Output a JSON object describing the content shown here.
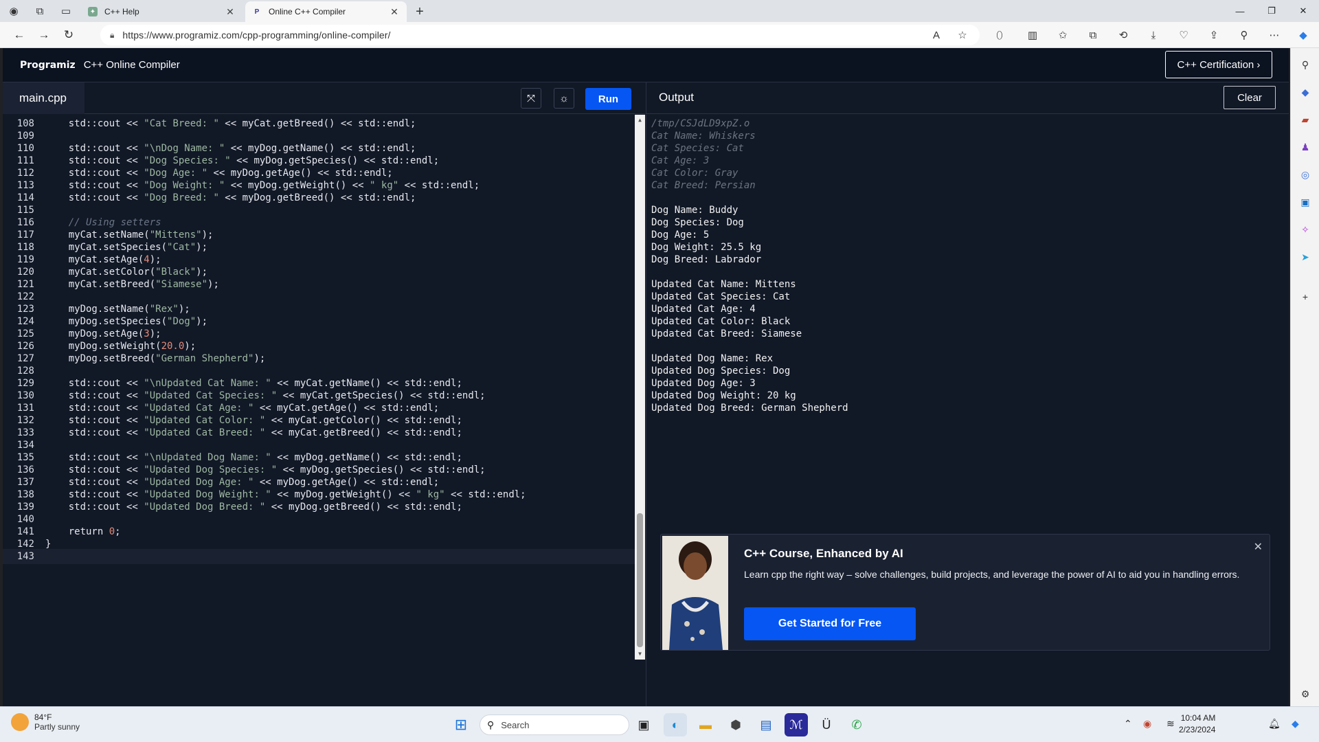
{
  "browser": {
    "tabs": [
      {
        "title": "C++ Help",
        "active": false
      },
      {
        "title": "Online C++ Compiler",
        "active": true
      }
    ],
    "url": "https://www.programiz.com/cpp-programming/online-compiler/"
  },
  "app": {
    "logo": "Programiz",
    "title": "C++ Online Compiler",
    "certification_button": "C++ Certification ›",
    "file_tab": "main.cpp",
    "run_button": "Run",
    "output_title": "Output",
    "clear_button": "Clear"
  },
  "code_lines": [
    {
      "n": "108",
      "code": "    std::cout << \"Cat Breed: \" << myCat.getBreed() << std::endl;"
    },
    {
      "n": "109",
      "code": ""
    },
    {
      "n": "110",
      "code": "    std::cout << \"\\nDog Name: \" << myDog.getName() << std::endl;"
    },
    {
      "n": "111",
      "code": "    std::cout << \"Dog Species: \" << myDog.getSpecies() << std::endl;"
    },
    {
      "n": "112",
      "code": "    std::cout << \"Dog Age: \" << myDog.getAge() << std::endl;"
    },
    {
      "n": "113",
      "code": "    std::cout << \"Dog Weight: \" << myDog.getWeight() << \" kg\" << std::endl;"
    },
    {
      "n": "114",
      "code": "    std::cout << \"Dog Breed: \" << myDog.getBreed() << std::endl;"
    },
    {
      "n": "115",
      "code": ""
    },
    {
      "n": "116",
      "code": "    // Using setters"
    },
    {
      "n": "117",
      "code": "    myCat.setName(\"Mittens\");"
    },
    {
      "n": "118",
      "code": "    myCat.setSpecies(\"Cat\");"
    },
    {
      "n": "119",
      "code": "    myCat.setAge(4);"
    },
    {
      "n": "120",
      "code": "    myCat.setColor(\"Black\");"
    },
    {
      "n": "121",
      "code": "    myCat.setBreed(\"Siamese\");"
    },
    {
      "n": "122",
      "code": ""
    },
    {
      "n": "123",
      "code": "    myDog.setName(\"Rex\");"
    },
    {
      "n": "124",
      "code": "    myDog.setSpecies(\"Dog\");"
    },
    {
      "n": "125",
      "code": "    myDog.setAge(3);"
    },
    {
      "n": "126",
      "code": "    myDog.setWeight(20.0);"
    },
    {
      "n": "127",
      "code": "    myDog.setBreed(\"German Shepherd\");"
    },
    {
      "n": "128",
      "code": ""
    },
    {
      "n": "129",
      "code": "    std::cout << \"\\nUpdated Cat Name: \" << myCat.getName() << std::endl;"
    },
    {
      "n": "130",
      "code": "    std::cout << \"Updated Cat Species: \" << myCat.getSpecies() << std::endl;"
    },
    {
      "n": "131",
      "code": "    std::cout << \"Updated Cat Age: \" << myCat.getAge() << std::endl;"
    },
    {
      "n": "132",
      "code": "    std::cout << \"Updated Cat Color: \" << myCat.getColor() << std::endl;"
    },
    {
      "n": "133",
      "code": "    std::cout << \"Updated Cat Breed: \" << myCat.getBreed() << std::endl;"
    },
    {
      "n": "134",
      "code": ""
    },
    {
      "n": "135",
      "code": "    std::cout << \"\\nUpdated Dog Name: \" << myDog.getName() << std::endl;"
    },
    {
      "n": "136",
      "code": "    std::cout << \"Updated Dog Species: \" << myDog.getSpecies() << std::endl;"
    },
    {
      "n": "137",
      "code": "    std::cout << \"Updated Dog Age: \" << myDog.getAge() << std::endl;"
    },
    {
      "n": "138",
      "code": "    std::cout << \"Updated Dog Weight: \" << myDog.getWeight() << \" kg\" << std::endl;"
    },
    {
      "n": "139",
      "code": "    std::cout << \"Updated Dog Breed: \" << myDog.getBreed() << std::endl;"
    },
    {
      "n": "140",
      "code": ""
    },
    {
      "n": "141",
      "code": "    return 0;"
    },
    {
      "n": "142",
      "code": "}"
    },
    {
      "n": "143",
      "code": ""
    }
  ],
  "output_lines": [
    {
      "text": "/tmp/CSJdLD9xpZ.o",
      "dim": true
    },
    {
      "text": "Cat Name: Whiskers",
      "dim": true
    },
    {
      "text": "Cat Species: Cat",
      "dim": true
    },
    {
      "text": "Cat Age: 3",
      "dim": true
    },
    {
      "text": "Cat Color: Gray",
      "dim": true
    },
    {
      "text": "Cat Breed: Persian",
      "dim": true
    },
    {
      "text": "",
      "dim": false
    },
    {
      "text": "Dog Name: Buddy",
      "dim": false
    },
    {
      "text": "Dog Species: Dog",
      "dim": false
    },
    {
      "text": "Dog Age: 5",
      "dim": false
    },
    {
      "text": "Dog Weight: 25.5 kg",
      "dim": false
    },
    {
      "text": "Dog Breed: Labrador",
      "dim": false
    },
    {
      "text": "",
      "dim": false
    },
    {
      "text": "Updated Cat Name: Mittens",
      "dim": false
    },
    {
      "text": "Updated Cat Species: Cat",
      "dim": false
    },
    {
      "text": "Updated Cat Age: 4",
      "dim": false
    },
    {
      "text": "Updated Cat Color: Black",
      "dim": false
    },
    {
      "text": "Updated Cat Breed: Siamese",
      "dim": false
    },
    {
      "text": "",
      "dim": false
    },
    {
      "text": "Updated Dog Name: Rex",
      "dim": false
    },
    {
      "text": "Updated Dog Species: Dog",
      "dim": false
    },
    {
      "text": "Updated Dog Age: 3",
      "dim": false
    },
    {
      "text": "Updated Dog Weight: 20 kg",
      "dim": false
    },
    {
      "text": "Updated Dog Breed: German Shepherd",
      "dim": false
    }
  ],
  "promo": {
    "title": "C++ Course, Enhanced by AI",
    "description": "Learn cpp the right way – solve challenges, build projects, and leverage the power of AI to aid you in handling errors.",
    "cta": "Get Started for Free"
  },
  "taskbar": {
    "temperature": "84°F",
    "condition": "Partly sunny",
    "search_placeholder": "Search",
    "time": "10:04 AM",
    "date": "2/23/2024"
  },
  "colors": {
    "brand_blue": "#0556f3",
    "editor_bg": "#111826",
    "string": "#9fb9a3",
    "number": "#e58c7a",
    "comment": "#6a7686"
  }
}
